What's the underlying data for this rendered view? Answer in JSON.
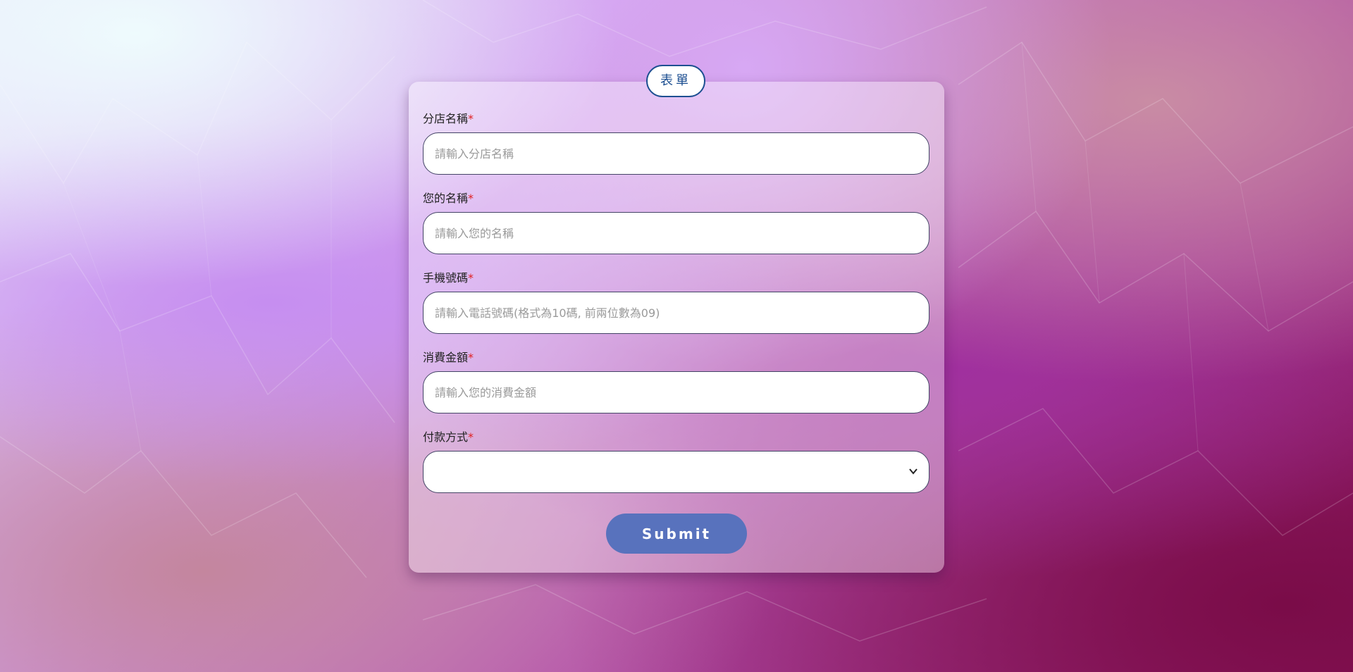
{
  "background": {
    "colors": [
      "#eefbfd",
      "#d4a6ef",
      "#b653b2",
      "#8c145e"
    ]
  },
  "form": {
    "badge_title": "表單",
    "required_mark": "*",
    "fields": [
      {
        "label": "分店名稱",
        "placeholder": "請輸入分店名稱",
        "value": ""
      },
      {
        "label": "您的名稱",
        "placeholder": "請輸入您的名稱",
        "value": ""
      },
      {
        "label": "手機號碼",
        "placeholder": "請輸入電話號碼(格式為10碼, 前兩位數為09)",
        "value": ""
      },
      {
        "label": "消費金額",
        "placeholder": "請輸入您的消費金額",
        "value": ""
      }
    ],
    "payment": {
      "label": "付款方式",
      "selected": ""
    },
    "submit_label": "Submit"
  },
  "colors": {
    "badge_border": "#1d4f91",
    "required": "#e02020",
    "submit_bg": "#5872bd"
  },
  "icons": {
    "select_chevron": "chevron-down-icon"
  }
}
